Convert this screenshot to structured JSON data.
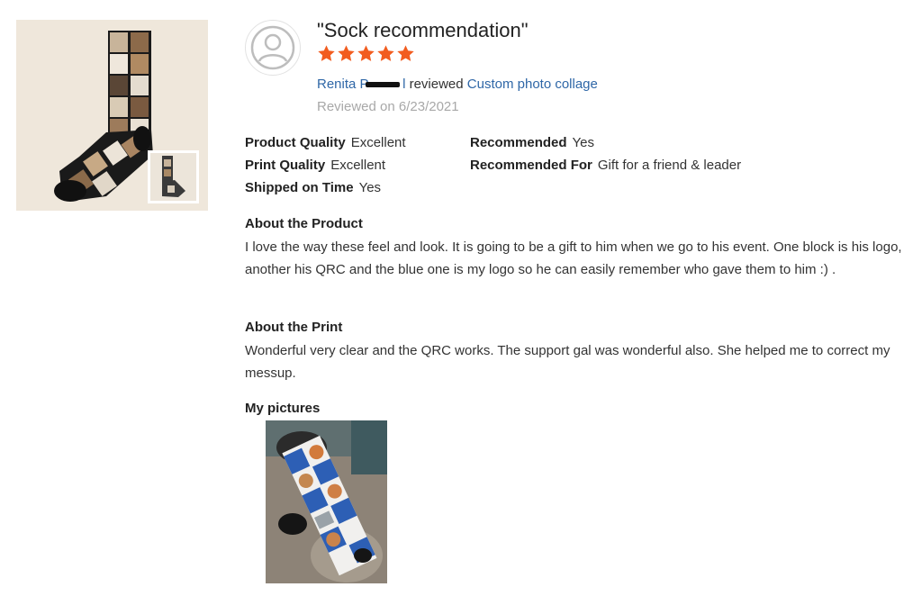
{
  "review": {
    "title": "\"Sock recommendation\"",
    "rating": 5,
    "rating_max": 5,
    "reviewer_name": "Renita P",
    "reviewer_name_tail": "l",
    "reviewed_text": " reviewed ",
    "product_link": "Custom photo collage",
    "date_text": "Reviewed on 6/23/2021"
  },
  "attributes": {
    "product_quality": {
      "label": "Product Quality",
      "value": "Excellent"
    },
    "print_quality": {
      "label": "Print Quality",
      "value": "Excellent"
    },
    "shipped_on_time": {
      "label": "Shipped on Time",
      "value": "Yes"
    },
    "recommended": {
      "label": "Recommended",
      "value": "Yes"
    },
    "recommended_for": {
      "label": "Recommended For",
      "value": "Gift for a friend & leader"
    }
  },
  "sections": {
    "about_product": {
      "heading": "About the Product",
      "body": "I love the way these feel and look. It is going to be a gift to him when we go to his event. One block is his logo, another his QRC and the blue one is my logo so he can easily remember who gave them to him :) ."
    },
    "about_print": {
      "heading": "About the Print",
      "body": "Wonderful very clear and the QRC works. The support gal was wonderful also. She helped me to correct my messup."
    },
    "my_pictures": {
      "heading": "My pictures"
    }
  },
  "colors": {
    "star": "#f25c1f",
    "link": "#2f67a7",
    "muted": "#a8a8a8"
  },
  "icons": {
    "avatar": "user-avatar-icon",
    "star": "star-icon"
  }
}
